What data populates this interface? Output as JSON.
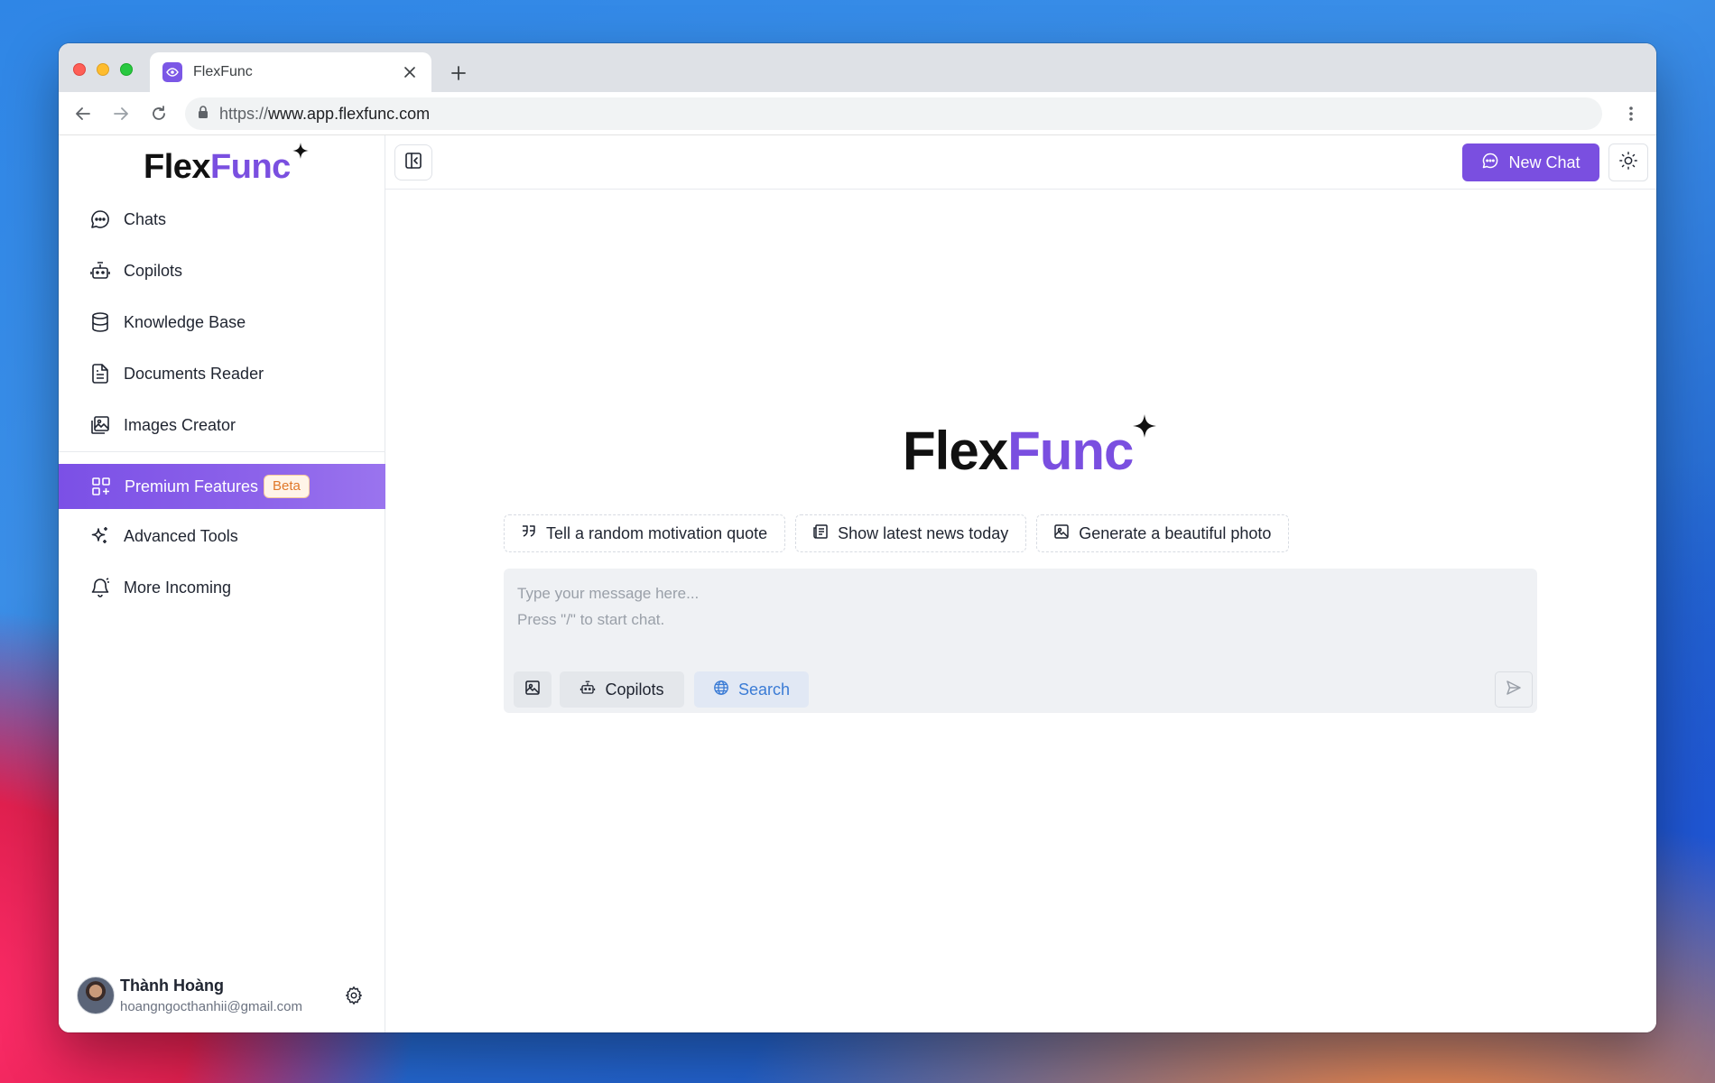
{
  "browser": {
    "tab_title": "FlexFunc",
    "url_scheme": "https://",
    "url_host": "www.app.flexfunc.com"
  },
  "brand": {
    "part1": "Flex",
    "part2": "Func",
    "accent_color": "#7a4fe0"
  },
  "sidebar": {
    "items": [
      {
        "label": "Chats",
        "icon": "chat-bubble-icon"
      },
      {
        "label": "Copilots",
        "icon": "robot-icon"
      },
      {
        "label": "Knowledge Base",
        "icon": "database-icon"
      },
      {
        "label": "Documents Reader",
        "icon": "document-icon"
      },
      {
        "label": "Images Creator",
        "icon": "image-icon"
      }
    ],
    "premium": {
      "label": "Premium Features",
      "badge": "Beta",
      "icon": "grid-icon"
    },
    "extras": [
      {
        "label": "Advanced Tools",
        "icon": "sparkle-icon"
      },
      {
        "label": "More Incoming",
        "icon": "bell-icon"
      }
    ],
    "user": {
      "name": "Thành Hoàng",
      "email": "hoangngocthanhii@gmail.com"
    }
  },
  "header": {
    "new_chat_label": "New Chat"
  },
  "suggestions": [
    {
      "label": "Tell a random motivation quote",
      "icon": "quote-icon"
    },
    {
      "label": "Show latest news today",
      "icon": "newspaper-icon"
    },
    {
      "label": "Generate a beautiful photo",
      "icon": "image-icon"
    }
  ],
  "composer": {
    "placeholder_line1": "Type your message here...",
    "placeholder_line2": "Press \"/\" to start chat.",
    "copilots_label": "Copilots",
    "search_label": "Search"
  }
}
